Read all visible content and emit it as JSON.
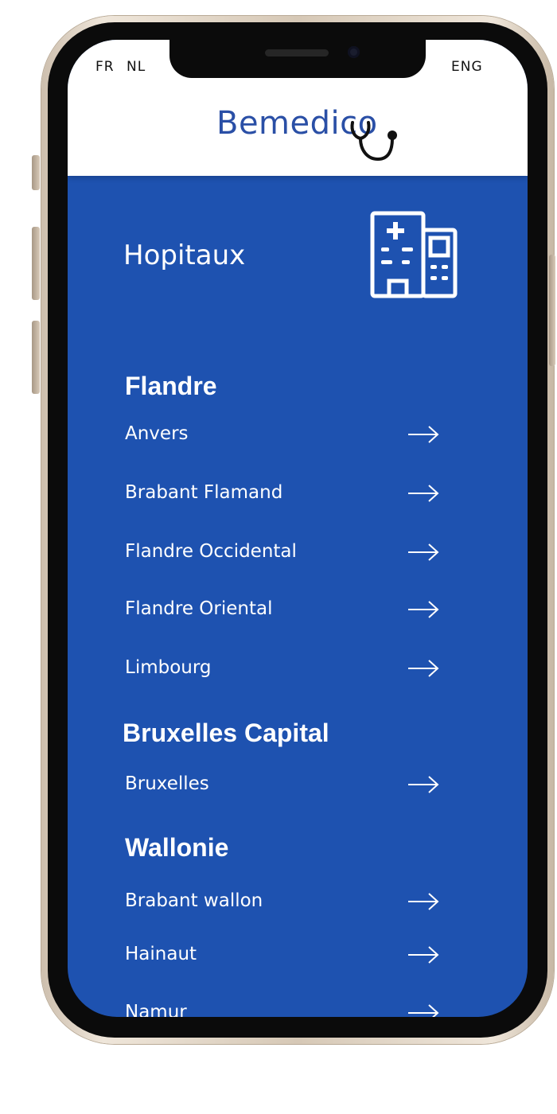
{
  "header": {
    "languages": [
      "FR",
      "NL",
      "ENG"
    ],
    "brand": "Bemedico",
    "brand_color": "#2a4fa6"
  },
  "main": {
    "title": "Hopitaux",
    "icon": "hospital-building-icon",
    "background_color": "#1e52b0",
    "regions": [
      {
        "name": "Flandre",
        "items": [
          "Anvers",
          "Brabant Flamand",
          "Flandre Occidental",
          "Flandre Oriental",
          "Limbourg"
        ]
      },
      {
        "name": "Bruxelles Capital",
        "items": [
          "Bruxelles"
        ]
      },
      {
        "name": "Wallonie",
        "items": [
          "Brabant wallon",
          "Hainaut",
          "Namur"
        ]
      }
    ],
    "item_icon": "arrow-right-icon"
  }
}
